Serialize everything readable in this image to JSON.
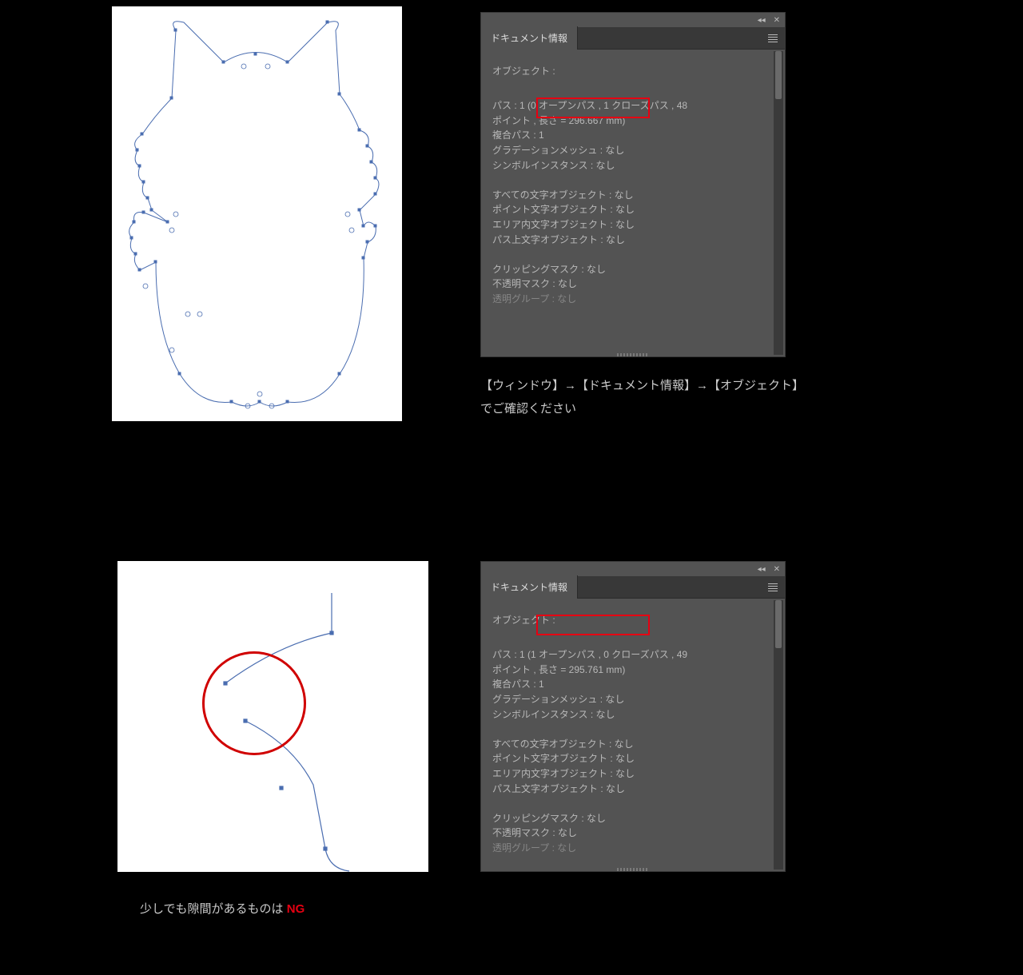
{
  "panel_title": "ドキュメント情報",
  "panel1": {
    "section_header": "オブジェクト :",
    "path_prefix": "パス : 1 ",
    "path_highlight": "(0 オープンパス ,",
    "path_suffix": " 1 クローズパス , 48",
    "points_line": "ポイント , 長さ = 296.667 mm)",
    "compound_path": "複合パス : 1",
    "gradient_mesh": "グラデーションメッシュ : なし",
    "symbol_instance": "シンボルインスタンス : なし",
    "all_text": "すべての文字オブジェクト : なし",
    "point_text": "ポイント文字オブジェクト : なし",
    "area_text": "エリア内文字オブジェクト : なし",
    "path_text": "パス上文字オブジェクト : なし",
    "clipping_mask": "クリッピングマスク : なし",
    "opacity_mask": "不透明マスク : なし",
    "cut_line": "透明グループ : なし"
  },
  "panel2": {
    "section_header": "オブジェクト :",
    "path_prefix": "パス : 1 ",
    "path_highlight": "(1 オープンパス ,",
    "path_suffix": " 0 クローズパス , 49",
    "points_line": "ポイント , 長さ = 295.761 mm)",
    "compound_path": "複合パス : 1",
    "gradient_mesh": "グラデーションメッシュ : なし",
    "symbol_instance": "シンボルインスタンス : なし",
    "all_text": "すべての文字オブジェクト : なし",
    "point_text": "ポイント文字オブジェクト : なし",
    "area_text": "エリア内文字オブジェクト : なし",
    "path_text": "パス上文字オブジェクト : なし",
    "clipping_mask": "クリッピングマスク : なし",
    "opacity_mask": "不透明マスク : なし",
    "cut_line": "透明グループ : なし"
  },
  "caption1": {
    "line1": "【ウィンドウ】→【ドキュメント情報】→【オブジェクト】",
    "line2": "でご確認ください"
  },
  "caption2": {
    "text": "少しでも隙間があるものは ",
    "ng": "NG"
  }
}
